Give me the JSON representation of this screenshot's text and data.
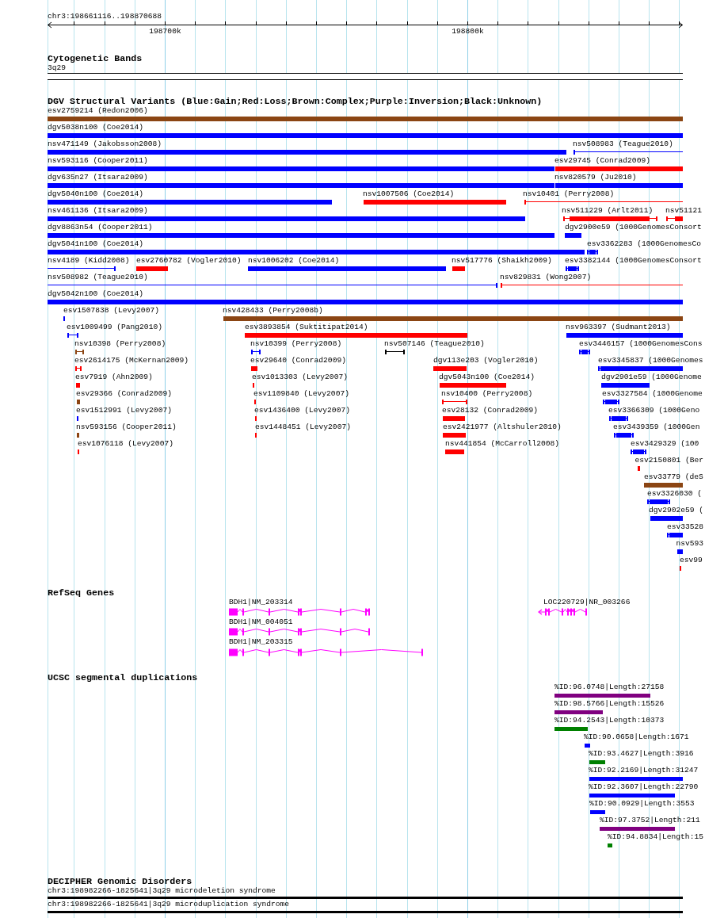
{
  "ruler": {
    "location": "chr3:198661116..198870688",
    "ticks": [
      "198700k",
      "198800k"
    ]
  },
  "tracks": [
    {
      "kind": "cytoband",
      "title": "Cytogenetic Bands",
      "features": [
        {
          "label": "3q29"
        }
      ]
    },
    {
      "kind": "variants",
      "title": "DGV Structural Variants (Blue:Gain;Red:Loss;Brown:Complex;Purple:Inversion;Black:Unknown)",
      "rows": [
        {
          "items": [
            {
              "label": "esv2759214 (Redon2006)",
              "color": "#8b4513"
            }
          ]
        },
        {
          "items": [
            {
              "label": "dgv5038n100 (Coe2014)",
              "color": "#0000ff"
            }
          ]
        },
        {
          "items": [
            {
              "label": "nsv471149 (Jakobsson2008)",
              "color": "#0000ff"
            },
            {
              "label": "nsv508983 (Teague2010)",
              "color": "#0000ff"
            }
          ]
        },
        {
          "items": [
            {
              "label": "nsv593116 (Cooper2011)",
              "color": "#0000ff"
            },
            {
              "label": "esv29745 (Conrad2009)",
              "color": "#ff0000"
            }
          ]
        },
        {
          "items": [
            {
              "label": "dgv635n27 (Itsara2009)",
              "color": "#0000ff"
            },
            {
              "label": "nsv820579 (Ju2010)",
              "color": "#0000ff"
            }
          ]
        },
        {
          "items": [
            {
              "label": "dgv5040n100 (Coe2014)",
              "color": "#0000ff"
            },
            {
              "label": "nsv1007506 (Coe2014)",
              "color": "#ff0000"
            },
            {
              "label": "nsv10401 (Perry2008)",
              "color": "#ff0000"
            }
          ]
        },
        {
          "items": [
            {
              "label": "nsv461136 (Itsara2009)",
              "color": "#0000ff"
            },
            {
              "label": "nsv511229 (Arlt2011)",
              "color": "#ff0000"
            },
            {
              "label": "nsv51121",
              "color": "#ff0000"
            }
          ]
        },
        {
          "items": [
            {
              "label": "dgv8863n54 (Cooper2011)",
              "color": "#0000ff"
            },
            {
              "label": "dgv2900e59 (1000GenomesConsort",
              "color": "#0000ff"
            }
          ]
        },
        {
          "items": [
            {
              "label": "dgv5041n100 (Coe2014)",
              "color": "#0000ff"
            },
            {
              "label": "esv3362283 (1000GenomesCo",
              "color": "#0000ff"
            }
          ]
        },
        {
          "items": [
            {
              "label": "nsv4189 (Kidd2008)",
              "color": "#0000ff"
            },
            {
              "label": "esv2760782 (Vogler2010)",
              "color": "#ff0000"
            },
            {
              "label": "nsv1006202 (Coe2014)",
              "color": "#0000ff"
            },
            {
              "label": "nsv517776 (Shaikh2009)",
              "color": "#ff0000"
            },
            {
              "label": "esv3382144 (1000GenomesConsort",
              "color": "#0000ff"
            }
          ]
        },
        {
          "items": [
            {
              "label": "nsv508982 (Teague2010)",
              "color": "#0000ff"
            },
            {
              "label": "nsv829831 (Wong2007)",
              "color": "#ff0000"
            }
          ]
        },
        {
          "items": [
            {
              "label": "dgv5042n100 (Coe2014)",
              "color": "#0000ff"
            }
          ]
        },
        {
          "items": [
            {
              "label": "esv1507838 (Levy2007)",
              "color": "#0000ff"
            },
            {
              "label": "nsv428433 (Perry2008b)",
              "color": "#8b4513"
            }
          ]
        },
        {
          "items": [
            {
              "label": "esv1009499 (Pang2010)",
              "color": "#0000ff"
            },
            {
              "label": "esv3893854 (Suktitipat2014)",
              "color": "#ff0000"
            },
            {
              "label": "nsv963397 (Sudmant2013)",
              "color": "#0000ff"
            }
          ]
        },
        {
          "items": [
            {
              "label": "nsv10398 (Perry2008)",
              "color": "#8b4513"
            },
            {
              "label": "nsv10399 (Perry2008)",
              "color": "#0000ff"
            },
            {
              "label": "nsv507146 (Teague2010)",
              "color": "#000000"
            },
            {
              "label": "esv3446157 (1000GenomesCons",
              "color": "#0000ff"
            }
          ]
        },
        {
          "items": [
            {
              "label": "esv2614175 (McKernan2009)",
              "color": "#ff0000"
            },
            {
              "label": "esv29640 (Conrad2009)",
              "color": "#ff0000"
            },
            {
              "label": "dgv113e203 (Vogler2010)",
              "color": "#ff0000"
            },
            {
              "label": "esv3345837 (1000Genomes",
              "color": "#0000ff"
            }
          ]
        },
        {
          "items": [
            {
              "label": "esv7919 (Ahn2009)",
              "color": "#ff0000"
            },
            {
              "label": "esv1013303 (Levy2007)",
              "color": "#ff0000"
            },
            {
              "label": "dgv5043n100 (Coe2014)",
              "color": "#ff0000"
            },
            {
              "label": "dgv2901e59 (1000Genome",
              "color": "#0000ff"
            }
          ]
        },
        {
          "items": [
            {
              "label": "esv29366 (Conrad2009)",
              "color": "#8b4513"
            },
            {
              "label": "esv1109840 (Levy2007)",
              "color": "#ff0000"
            },
            {
              "label": "nsv10400 (Perry2008)",
              "color": "#ff0000"
            },
            {
              "label": "esv3327584 (1000Genome",
              "color": "#0000ff"
            }
          ]
        },
        {
          "items": [
            {
              "label": "esv1512991 (Levy2007)",
              "color": "#0000ff"
            },
            {
              "label": "esv1436400 (Levy2007)",
              "color": "#ff0000"
            },
            {
              "label": "esv28132 (Conrad2009)",
              "color": "#ff0000"
            },
            {
              "label": "esv3366309 (1000Geno",
              "color": "#0000ff"
            }
          ]
        },
        {
          "items": [
            {
              "label": "nsv593156 (Cooper2011)",
              "color": "#8b4513"
            },
            {
              "label": "esv1448451 (Levy2007)",
              "color": "#ff0000"
            },
            {
              "label": "esv2421977 (Altshuler2010)",
              "color": "#ff0000"
            },
            {
              "label": "esv3439359 (1000Gen",
              "color": "#0000ff"
            }
          ]
        },
        {
          "items": [
            {
              "label": "esv1076118 (Levy2007)",
              "color": "#ff0000"
            },
            {
              "label": "nsv441854 (McCarroll2008)",
              "color": "#ff0000"
            },
            {
              "label": "esv3429329 (100",
              "color": "#0000ff"
            }
          ]
        },
        {
          "items": [
            {
              "label": "esv2150801 (Ber",
              "color": "#ff0000"
            }
          ]
        },
        {
          "items": [
            {
              "label": "esv33779 (deS",
              "color": "#8b4513"
            }
          ]
        },
        {
          "items": [
            {
              "label": "esv3326030 (",
              "color": "#0000ff"
            }
          ]
        },
        {
          "items": [
            {
              "label": "dgv2902e59 (",
              "color": "#0000ff"
            }
          ]
        },
        {
          "items": [
            {
              "label": "esv33528",
              "color": "#0000ff"
            }
          ]
        },
        {
          "items": [
            {
              "label": "nsv593",
              "color": "#0000ff"
            }
          ]
        },
        {
          "items": [
            {
              "label": "esv99",
              "color": "#ff0000"
            }
          ]
        }
      ]
    },
    {
      "kind": "genes",
      "title": "RefSeq Genes",
      "features": [
        {
          "label": "BDH1|NM_203314"
        },
        {
          "label": "LOC220729|NR_003266"
        },
        {
          "label": "BDH1|NM_004051"
        },
        {
          "label": "BDH1|NM_203315"
        }
      ]
    },
    {
      "kind": "segdups",
      "title": "UCSC segmental duplications",
      "features": [
        {
          "label": "%ID:96.0748|Length:27158",
          "color": "#800080"
        },
        {
          "label": "%ID:98.5766|Length:15526",
          "color": "#800080"
        },
        {
          "label": "%ID:94.2543|Length:10373",
          "color": "#008000"
        },
        {
          "label": "%ID:90.0658|Length:1671",
          "color": "#0000ff"
        },
        {
          "label": "%ID:93.4627|Length:3916",
          "color": "#008000"
        },
        {
          "label": "%ID:92.2169|Length:31247",
          "color": "#0000ff"
        },
        {
          "label": "%ID:92.3607|Length:22790",
          "color": "#0000ff"
        },
        {
          "label": "%ID:90.0929|Length:3553",
          "color": "#0000ff"
        },
        {
          "label": "%ID:97.3752|Length:211",
          "color": "#800080"
        },
        {
          "label": "%ID:94.8834|Length:15",
          "color": "#008000"
        }
      ]
    },
    {
      "kind": "disorders",
      "title": "DECIPHER Genomic Disorders",
      "features": [
        {
          "label": "chr3:198982266-1825641|3q29 microdeletion syndrome"
        },
        {
          "label": "chr3:198982266-1825641|3q29 microduplication syndrome"
        }
      ]
    }
  ]
}
